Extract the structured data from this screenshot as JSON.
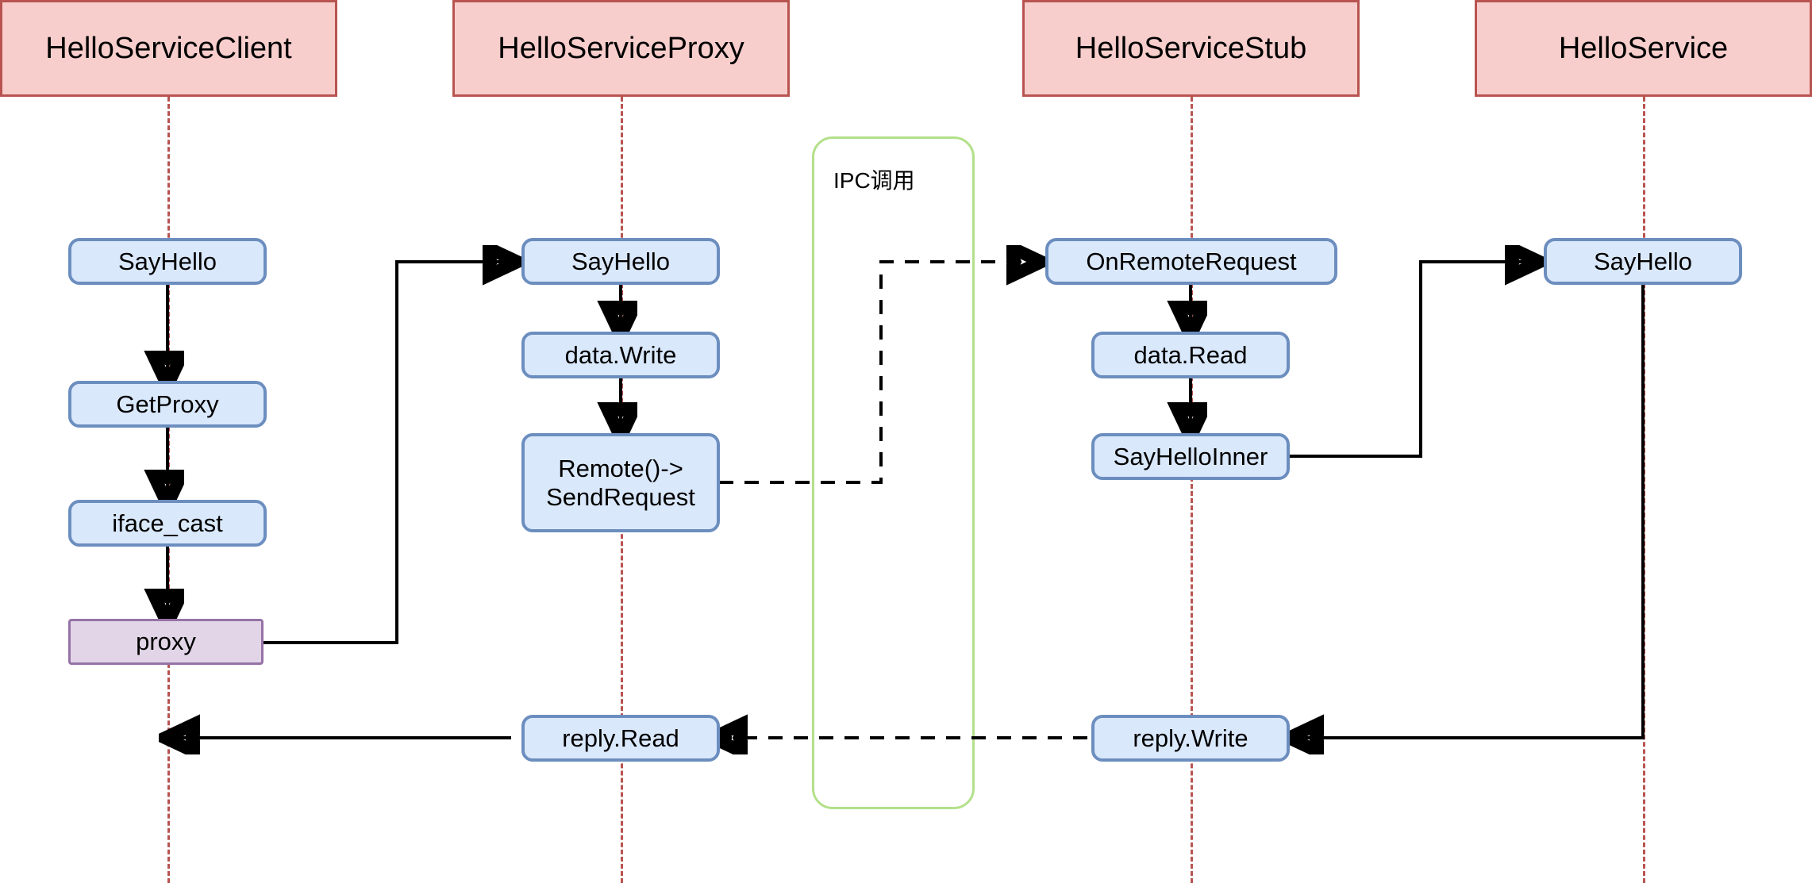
{
  "diagram": {
    "title_visible": false,
    "type": "sequence-diagram",
    "colors": {
      "actor_fill": "#f8cecc",
      "actor_border": "#b85450",
      "node_fill": "#dae8fc",
      "node_border": "#6c8ebf",
      "object_fill": "#e1d5e7",
      "object_border": "#9673a6",
      "frame_border": "#b3e08a",
      "lifeline": "#b85450",
      "arrow": "#000000"
    },
    "actors": [
      {
        "id": "client",
        "label": "HelloServiceClient"
      },
      {
        "id": "proxy",
        "label": "HelloServiceProxy"
      },
      {
        "id": "stub",
        "label": "HelloServiceStub"
      },
      {
        "id": "service",
        "label": "HelloService"
      }
    ],
    "frames": [
      {
        "id": "ipc",
        "label": "IPC调用"
      }
    ],
    "nodes": [
      {
        "id": "c1",
        "actor": "client",
        "label": "SayHello",
        "kind": "step"
      },
      {
        "id": "c2",
        "actor": "client",
        "label": "GetProxy",
        "kind": "step"
      },
      {
        "id": "c3",
        "actor": "client",
        "label": "iface_cast",
        "kind": "step"
      },
      {
        "id": "c4",
        "actor": "client",
        "label": "proxy",
        "kind": "object"
      },
      {
        "id": "p1",
        "actor": "proxy",
        "label": "SayHello",
        "kind": "step"
      },
      {
        "id": "p2",
        "actor": "proxy",
        "label": "data.Write",
        "kind": "step"
      },
      {
        "id": "p3",
        "actor": "proxy",
        "label_line1": "Remote()->",
        "label_line2": "SendRequest",
        "kind": "step"
      },
      {
        "id": "p4",
        "actor": "proxy",
        "label": "reply.Read",
        "kind": "step"
      },
      {
        "id": "s1",
        "actor": "stub",
        "label": "OnRemoteRequest",
        "kind": "step"
      },
      {
        "id": "s2",
        "actor": "stub",
        "label": "data.Read",
        "kind": "step"
      },
      {
        "id": "s3",
        "actor": "stub",
        "label": "SayHelloInner",
        "kind": "step"
      },
      {
        "id": "s4",
        "actor": "stub",
        "label": "reply.Write",
        "kind": "step"
      },
      {
        "id": "v1",
        "actor": "service",
        "label": "SayHello",
        "kind": "step"
      }
    ],
    "edges": [
      {
        "from": "c1",
        "to": "c2",
        "style": "solid"
      },
      {
        "from": "c2",
        "to": "c3",
        "style": "solid"
      },
      {
        "from": "c3",
        "to": "c4",
        "style": "solid"
      },
      {
        "from": "c4",
        "to": "p1",
        "style": "solid"
      },
      {
        "from": "p1",
        "to": "p2",
        "style": "solid"
      },
      {
        "from": "p2",
        "to": "p3",
        "style": "solid"
      },
      {
        "from": "p3",
        "to": "s1",
        "style": "dashed"
      },
      {
        "from": "s1",
        "to": "s2",
        "style": "solid"
      },
      {
        "from": "s2",
        "to": "s3",
        "style": "solid"
      },
      {
        "from": "s3",
        "to": "v1",
        "style": "solid"
      },
      {
        "from": "v1",
        "to": "s4",
        "style": "solid"
      },
      {
        "from": "s4",
        "to": "p4",
        "style": "dashed"
      },
      {
        "from": "p4",
        "to": "client_lifeline",
        "style": "solid"
      }
    ]
  }
}
